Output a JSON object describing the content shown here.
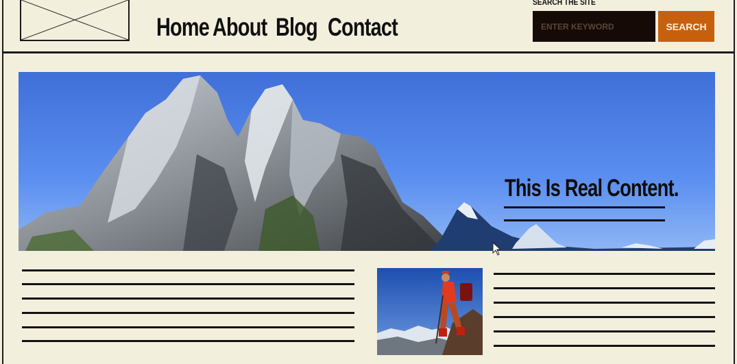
{
  "nav": {
    "items": [
      "Home",
      "About",
      "Blog",
      "Contact"
    ]
  },
  "search": {
    "label": "SEARCH THE SITE",
    "placeholder": "ENTER KEYWORD",
    "button_label": "SEARCH"
  },
  "hero": {
    "title": "This Is Real Content."
  },
  "colors": {
    "background": "#f3efdd",
    "search_input": "#160a06",
    "search_button": "#c7600d",
    "rule": "#111111"
  },
  "icons": {
    "logo_placeholder": "image-placeholder-icon",
    "cursor": "mouse-cursor-icon"
  }
}
